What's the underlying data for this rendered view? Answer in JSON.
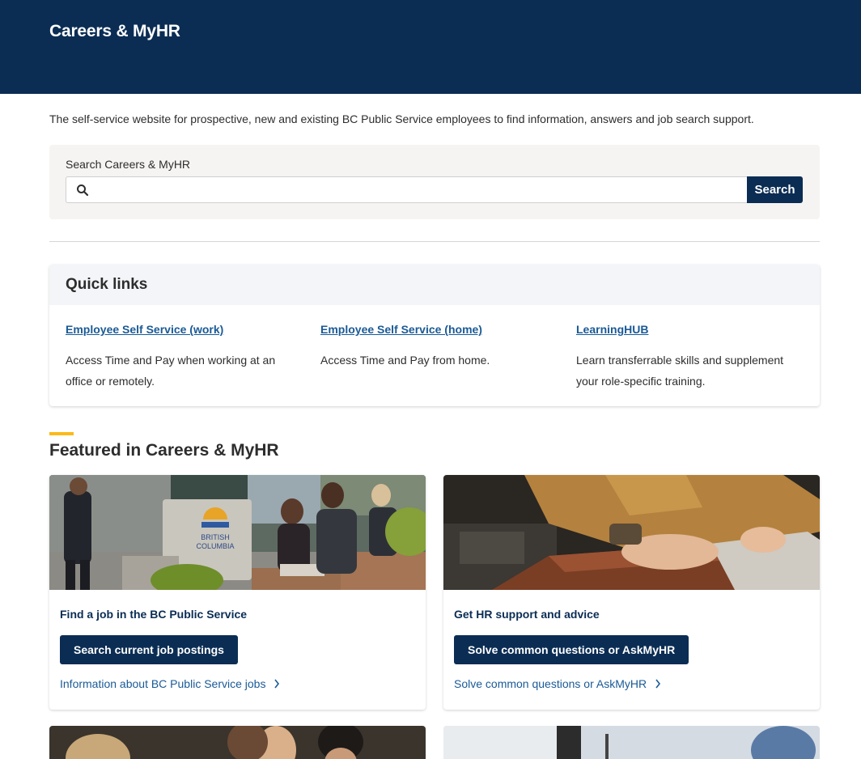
{
  "header": {
    "title": "Careers & MyHR"
  },
  "intro": {
    "text": "The self-service website for prospective, new and existing BC Public Service employees to find information, answers and job search support."
  },
  "search": {
    "label": "Search Careers & MyHR",
    "value": "",
    "placeholder": "",
    "button_label": "Search",
    "icon": "search-icon"
  },
  "quick_links": {
    "title": "Quick links",
    "items": [
      {
        "link": "Employee Self Service (work)",
        "desc": "Access Time and Pay when working at an office or remotely."
      },
      {
        "link": "Employee Self Service (home)",
        "desc": "Access Time and Pay from home."
      },
      {
        "link": "LearningHUB",
        "desc": "Learn transferrable skills and supplement your role-specific training."
      }
    ]
  },
  "featured": {
    "title": "Featured in Careers & MyHR",
    "cards": [
      {
        "title": "Find a job in the BC Public Service",
        "button": "Search current job postings",
        "link": "Information about BC Public Service jobs",
        "sign_text": [
          "BRITISH",
          "COLUMBIA"
        ]
      },
      {
        "title": "Get HR support and advice",
        "button": "Solve common questions or AskMyHR",
        "link": "Solve common questions or AskMyHR"
      }
    ]
  },
  "colors": {
    "brand_navy": "#0b2d54",
    "link_blue": "#1a5a96",
    "accent_gold": "#fcba19",
    "panel_bg": "#f6f4f2"
  }
}
